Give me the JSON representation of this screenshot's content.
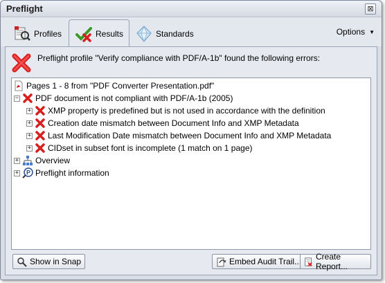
{
  "window": {
    "title": "Preflight",
    "close_glyph": "⊠"
  },
  "tabs": [
    {
      "label": "Profiles",
      "icon": "profiles-icon",
      "active": false
    },
    {
      "label": "Results",
      "icon": "results-checkmark-icon",
      "active": true
    },
    {
      "label": "Standards",
      "icon": "standards-diamond-icon",
      "active": false
    }
  ],
  "options": {
    "label": "Options",
    "arrow": "▼"
  },
  "message": {
    "text": "Preflight profile \"Verify compliance with PDF/A-1b\" found the following errors:",
    "icon": "error-x-icon"
  },
  "tree": [
    {
      "text": "Pages 1 - 8 from \"PDF Converter Presentation.pdf\"",
      "icon": "pdf-document-icon",
      "expander": ""
    },
    {
      "text": "PDF document is not compliant with PDF/A-1b (2005)",
      "icon": "error-x-icon",
      "expander": "−"
    },
    {
      "text": "XMP property is predefined but is not used in accordance with the definition",
      "icon": "error-x-icon",
      "expander": "+"
    },
    {
      "text": "Creation date mismatch between Document Info and XMP Metadata",
      "icon": "error-x-icon",
      "expander": "+"
    },
    {
      "text": "Last Modification Date mismatch between Document Info and XMP Metadata",
      "icon": "error-x-icon",
      "expander": "+"
    },
    {
      "text": "CIDset in subset font is incomplete (1 match on 1 page)",
      "icon": "error-x-icon",
      "expander": "+"
    },
    {
      "text": "Overview",
      "icon": "overview-hierarchy-icon",
      "expander": "+"
    },
    {
      "text": "Preflight information",
      "icon": "preflight-info-icon",
      "expander": "+"
    }
  ],
  "buttons": {
    "show_in_snap": "Show in Snap",
    "embed_audit_trail": "Embed Audit Trail...",
    "create_report": "Create Report..."
  },
  "colors": {
    "error_red": "#d81e1e",
    "check_green": "#3a9a2a",
    "panel_bg": "#e6eaf0"
  }
}
